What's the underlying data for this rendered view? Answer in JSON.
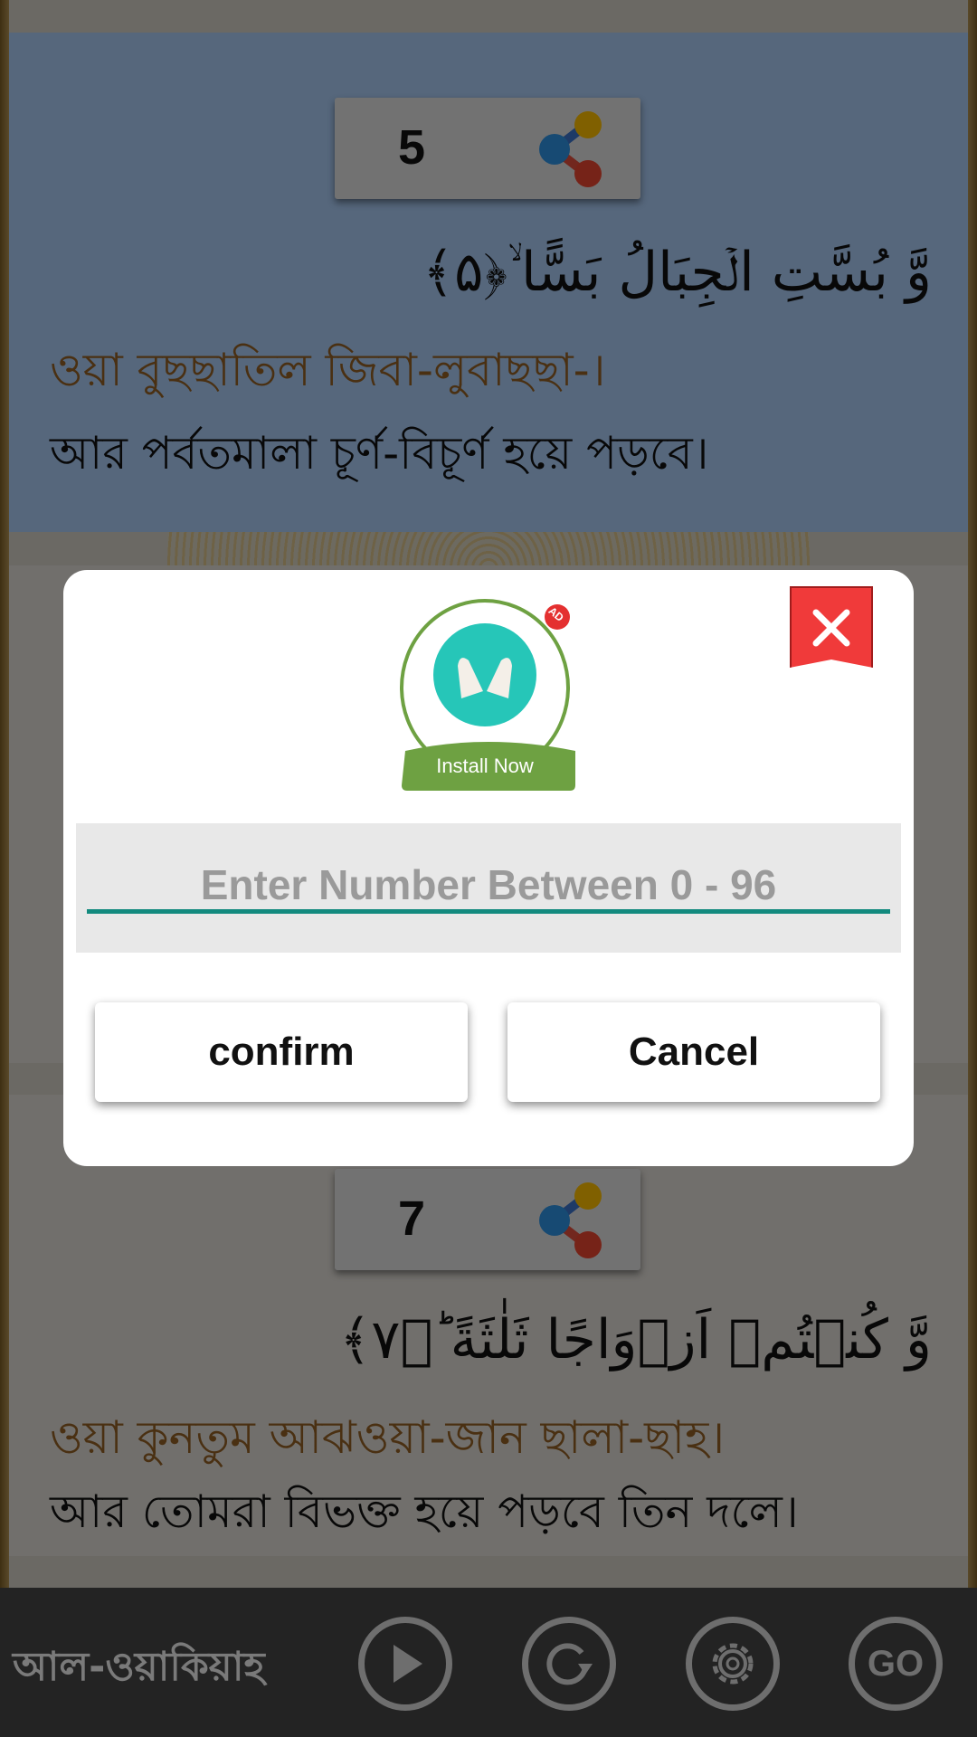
{
  "verses": [
    {
      "number": "5",
      "arabic": "وَّ بُسَّتِ الۡجِبَالُ بَسًّا ۙ﴿۵﴾",
      "transliteration": "ওয়া বুছছাতিল জিবা-লুবাছছা-।",
      "translation": "আর পর্বতমালা চূর্ণ-বিচূর্ণ হয়ে পড়বে।",
      "highlight": "#bcd4ef"
    },
    {
      "number": "7",
      "arabic": "وَّ كُنۡتُمۡ اَزۡوَاجًا ثَلٰثَةً ؕ﴿۷﴾",
      "transliteration": "ওয়া কুনতুম আঝওয়া-জান ছালা-ছাহ।",
      "translation": "আর তোমরা বিভক্ত হয়ে পড়বে তিন দলে।"
    }
  ],
  "dialog": {
    "ad": {
      "badge": "AD",
      "install_label": "Install Now",
      "icon": "praying-hands-icon"
    },
    "close_icon": "close-icon",
    "input_placeholder": "Enter Number Between 0 - 96",
    "input_value": "",
    "confirm_label": "confirm",
    "cancel_label": "Cancel",
    "accent": "#138a7e"
  },
  "bottom_bar": {
    "surah_name": "আল-ওয়াকিয়াহ",
    "buttons": [
      "play-icon",
      "repeat-icon",
      "gear-icon",
      "go-icon"
    ],
    "go_label": "GO"
  }
}
